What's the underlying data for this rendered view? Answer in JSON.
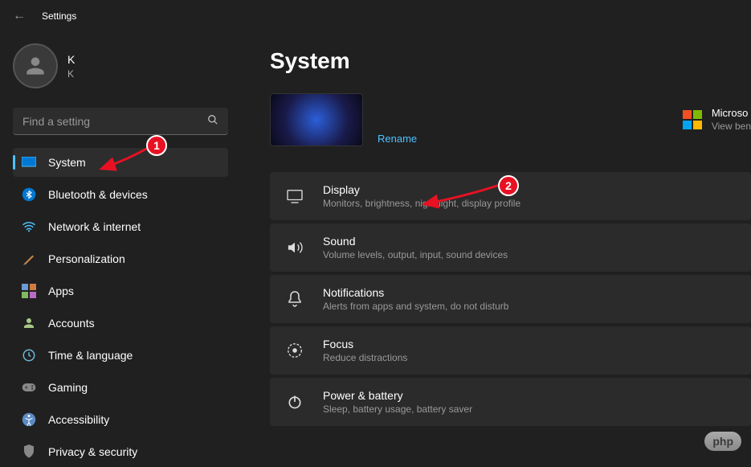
{
  "titlebar": {
    "title": "Settings"
  },
  "user": {
    "initial": "K",
    "sub": "K"
  },
  "search": {
    "placeholder": "Find a setting"
  },
  "sidebar": {
    "items": [
      {
        "label": "System"
      },
      {
        "label": "Bluetooth & devices"
      },
      {
        "label": "Network & internet"
      },
      {
        "label": "Personalization"
      },
      {
        "label": "Apps"
      },
      {
        "label": "Accounts"
      },
      {
        "label": "Time & language"
      },
      {
        "label": "Gaming"
      },
      {
        "label": "Accessibility"
      },
      {
        "label": "Privacy & security"
      }
    ]
  },
  "page": {
    "title": "System",
    "rename": "Rename",
    "ms365": {
      "title": "Microso",
      "sub": "View ben"
    }
  },
  "settings": [
    {
      "title": "Display",
      "desc": "Monitors, brightness, night light, display profile"
    },
    {
      "title": "Sound",
      "desc": "Volume levels, output, input, sound devices"
    },
    {
      "title": "Notifications",
      "desc": "Alerts from apps and system, do not disturb"
    },
    {
      "title": "Focus",
      "desc": "Reduce distractions"
    },
    {
      "title": "Power & battery",
      "desc": "Sleep, battery usage, battery saver"
    }
  ],
  "annotations": {
    "badge1": "1",
    "badge2": "2"
  },
  "watermark": {
    "text": "php"
  }
}
